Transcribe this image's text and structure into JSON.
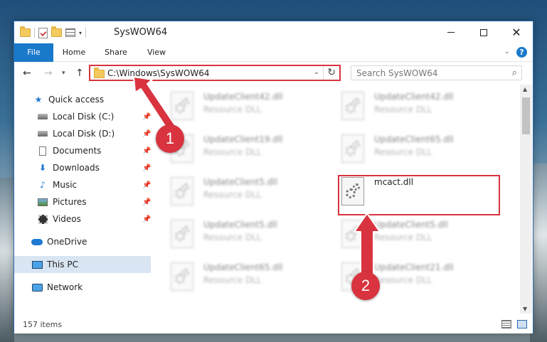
{
  "window": {
    "title": "SysWOW64",
    "controls": {
      "minimize": "—",
      "maximize": "☐",
      "close": "✕"
    }
  },
  "ribbon": {
    "tabs": [
      "File",
      "Home",
      "Share",
      "View"
    ],
    "help": "?"
  },
  "navigation": {
    "back": "←",
    "forward": "→",
    "recent": "▾",
    "up": "↑",
    "address": "C:\\Windows\\SysWOW64",
    "search_placeholder": "Search SysWOW64"
  },
  "sidebar": {
    "items": [
      {
        "label": "Quick access",
        "icon": "star-icon",
        "pinned": false
      },
      {
        "label": "Local Disk (C:)",
        "icon": "disk-icon",
        "pinned": true
      },
      {
        "label": "Local Disk (D:)",
        "icon": "disk-icon",
        "pinned": true
      },
      {
        "label": "Documents",
        "icon": "documents-icon",
        "pinned": true
      },
      {
        "label": "Downloads",
        "icon": "downloads-icon",
        "pinned": true
      },
      {
        "label": "Music",
        "icon": "music-icon",
        "pinned": true
      },
      {
        "label": "Pictures",
        "icon": "pictures-icon",
        "pinned": true
      },
      {
        "label": "Videos",
        "icon": "videos-icon",
        "pinned": true
      },
      {
        "label": "OneDrive",
        "icon": "onedrive-icon",
        "pinned": false
      },
      {
        "label": "This PC",
        "icon": "this-pc-icon",
        "pinned": false,
        "selected": true
      },
      {
        "label": "Network",
        "icon": "network-icon",
        "pinned": false
      }
    ]
  },
  "files": [
    {
      "name": "UpdateClient42.dll",
      "type": "Resource DLL",
      "blurred": true
    },
    {
      "name": "UpdateClient42.dll",
      "type": "Resource DLL",
      "blurred": true
    },
    {
      "name": "UpdateClient19.dll",
      "type": "Resource DLL",
      "blurred": true
    },
    {
      "name": "UpdateClient65.dll",
      "type": "Resource DLL",
      "blurred": true
    },
    {
      "name": "UpdateClient5.dll",
      "type": "Resource DLL",
      "blurred": true
    },
    {
      "name": "mcact.dll",
      "type": "",
      "blurred": false,
      "highlighted": true
    },
    {
      "name": "UpdateClient5.dll",
      "type": "Resource DLL",
      "blurred": true
    },
    {
      "name": "UpdateClient5.dll",
      "type": "Resource DLL",
      "blurred": true
    },
    {
      "name": "UpdateClient65.dll",
      "type": "Resource DLL",
      "blurred": true
    },
    {
      "name": "UpdateClient21.dll",
      "type": "Resource DLL",
      "blurred": true
    }
  ],
  "status": {
    "item_count": "157 items"
  },
  "callouts": {
    "one": "1",
    "two": "2"
  },
  "colors": {
    "accent": "#1979ca",
    "highlight": "#d9333f"
  }
}
